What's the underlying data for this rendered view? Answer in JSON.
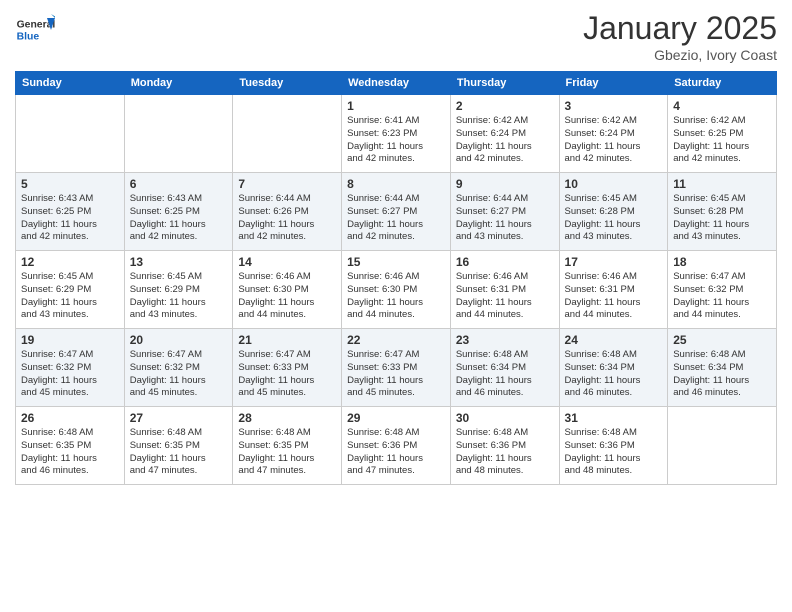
{
  "logo": {
    "general": "General",
    "blue": "Blue",
    "icon_color": "#1565c0"
  },
  "header": {
    "month_year": "January 2025",
    "location": "Gbezio, Ivory Coast"
  },
  "weekdays": [
    "Sunday",
    "Monday",
    "Tuesday",
    "Wednesday",
    "Thursday",
    "Friday",
    "Saturday"
  ],
  "weeks": [
    [
      {
        "day": "",
        "info": ""
      },
      {
        "day": "",
        "info": ""
      },
      {
        "day": "",
        "info": ""
      },
      {
        "day": "1",
        "info": "Sunrise: 6:41 AM\nSunset: 6:23 PM\nDaylight: 11 hours\nand 42 minutes."
      },
      {
        "day": "2",
        "info": "Sunrise: 6:42 AM\nSunset: 6:24 PM\nDaylight: 11 hours\nand 42 minutes."
      },
      {
        "day": "3",
        "info": "Sunrise: 6:42 AM\nSunset: 6:24 PM\nDaylight: 11 hours\nand 42 minutes."
      },
      {
        "day": "4",
        "info": "Sunrise: 6:42 AM\nSunset: 6:25 PM\nDaylight: 11 hours\nand 42 minutes."
      }
    ],
    [
      {
        "day": "5",
        "info": "Sunrise: 6:43 AM\nSunset: 6:25 PM\nDaylight: 11 hours\nand 42 minutes."
      },
      {
        "day": "6",
        "info": "Sunrise: 6:43 AM\nSunset: 6:25 PM\nDaylight: 11 hours\nand 42 minutes."
      },
      {
        "day": "7",
        "info": "Sunrise: 6:44 AM\nSunset: 6:26 PM\nDaylight: 11 hours\nand 42 minutes."
      },
      {
        "day": "8",
        "info": "Sunrise: 6:44 AM\nSunset: 6:27 PM\nDaylight: 11 hours\nand 42 minutes."
      },
      {
        "day": "9",
        "info": "Sunrise: 6:44 AM\nSunset: 6:27 PM\nDaylight: 11 hours\nand 43 minutes."
      },
      {
        "day": "10",
        "info": "Sunrise: 6:45 AM\nSunset: 6:28 PM\nDaylight: 11 hours\nand 43 minutes."
      },
      {
        "day": "11",
        "info": "Sunrise: 6:45 AM\nSunset: 6:28 PM\nDaylight: 11 hours\nand 43 minutes."
      }
    ],
    [
      {
        "day": "12",
        "info": "Sunrise: 6:45 AM\nSunset: 6:29 PM\nDaylight: 11 hours\nand 43 minutes."
      },
      {
        "day": "13",
        "info": "Sunrise: 6:45 AM\nSunset: 6:29 PM\nDaylight: 11 hours\nand 43 minutes."
      },
      {
        "day": "14",
        "info": "Sunrise: 6:46 AM\nSunset: 6:30 PM\nDaylight: 11 hours\nand 44 minutes."
      },
      {
        "day": "15",
        "info": "Sunrise: 6:46 AM\nSunset: 6:30 PM\nDaylight: 11 hours\nand 44 minutes."
      },
      {
        "day": "16",
        "info": "Sunrise: 6:46 AM\nSunset: 6:31 PM\nDaylight: 11 hours\nand 44 minutes."
      },
      {
        "day": "17",
        "info": "Sunrise: 6:46 AM\nSunset: 6:31 PM\nDaylight: 11 hours\nand 44 minutes."
      },
      {
        "day": "18",
        "info": "Sunrise: 6:47 AM\nSunset: 6:32 PM\nDaylight: 11 hours\nand 44 minutes."
      }
    ],
    [
      {
        "day": "19",
        "info": "Sunrise: 6:47 AM\nSunset: 6:32 PM\nDaylight: 11 hours\nand 45 minutes."
      },
      {
        "day": "20",
        "info": "Sunrise: 6:47 AM\nSunset: 6:32 PM\nDaylight: 11 hours\nand 45 minutes."
      },
      {
        "day": "21",
        "info": "Sunrise: 6:47 AM\nSunset: 6:33 PM\nDaylight: 11 hours\nand 45 minutes."
      },
      {
        "day": "22",
        "info": "Sunrise: 6:47 AM\nSunset: 6:33 PM\nDaylight: 11 hours\nand 45 minutes."
      },
      {
        "day": "23",
        "info": "Sunrise: 6:48 AM\nSunset: 6:34 PM\nDaylight: 11 hours\nand 46 minutes."
      },
      {
        "day": "24",
        "info": "Sunrise: 6:48 AM\nSunset: 6:34 PM\nDaylight: 11 hours\nand 46 minutes."
      },
      {
        "day": "25",
        "info": "Sunrise: 6:48 AM\nSunset: 6:34 PM\nDaylight: 11 hours\nand 46 minutes."
      }
    ],
    [
      {
        "day": "26",
        "info": "Sunrise: 6:48 AM\nSunset: 6:35 PM\nDaylight: 11 hours\nand 46 minutes."
      },
      {
        "day": "27",
        "info": "Sunrise: 6:48 AM\nSunset: 6:35 PM\nDaylight: 11 hours\nand 47 minutes."
      },
      {
        "day": "28",
        "info": "Sunrise: 6:48 AM\nSunset: 6:35 PM\nDaylight: 11 hours\nand 47 minutes."
      },
      {
        "day": "29",
        "info": "Sunrise: 6:48 AM\nSunset: 6:36 PM\nDaylight: 11 hours\nand 47 minutes."
      },
      {
        "day": "30",
        "info": "Sunrise: 6:48 AM\nSunset: 6:36 PM\nDaylight: 11 hours\nand 48 minutes."
      },
      {
        "day": "31",
        "info": "Sunrise: 6:48 AM\nSunset: 6:36 PM\nDaylight: 11 hours\nand 48 minutes."
      },
      {
        "day": "",
        "info": ""
      }
    ]
  ]
}
